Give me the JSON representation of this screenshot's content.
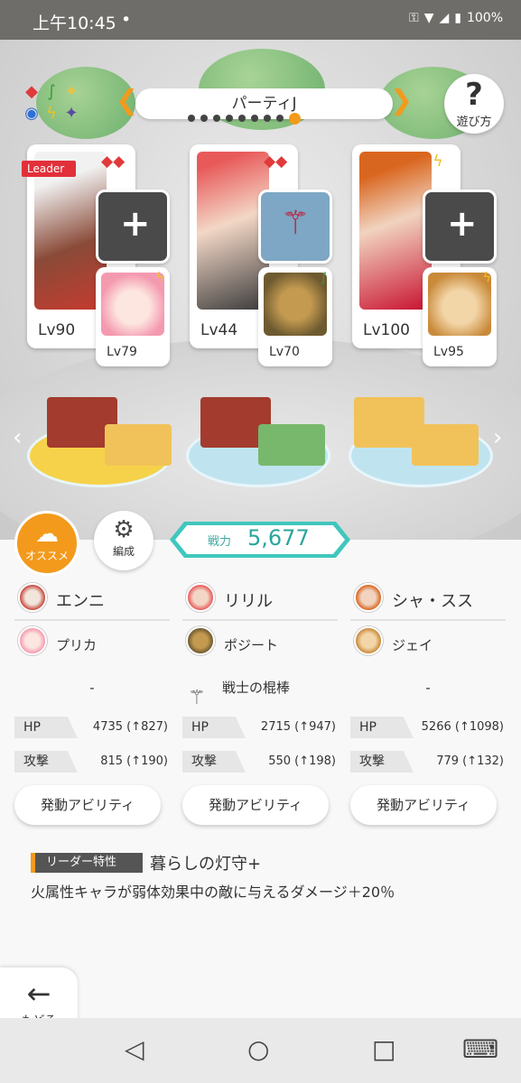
{
  "status": {
    "time": "上午10:45",
    "dot": "•",
    "battery": "100%"
  },
  "header": {
    "party_title": "パーティJ",
    "howto_label": "遊び方",
    "pages": 9,
    "active_page": 9
  },
  "colors": {
    "accent": "#f39a1c",
    "teal": "#3fc7bd",
    "fire": "#e03a3a"
  },
  "cards": [
    {
      "leader_label": "Leader",
      "level": "Lv90",
      "element": "fire",
      "sub_level": "Lv79",
      "slot": "empty"
    },
    {
      "level": "Lv44",
      "element": "fire",
      "sub_level": "Lv70",
      "slot": "weapon"
    },
    {
      "level": "Lv100",
      "element": "thunder",
      "sub_level": "Lv95",
      "slot": "empty"
    }
  ],
  "buttons": {
    "recommend": "オススメ",
    "formation": "編成",
    "back": "もどる"
  },
  "power": {
    "label": "戦力",
    "value": "5,677"
  },
  "columns": [
    {
      "main": "エンニ",
      "sub": "プリカ",
      "weapon": "-",
      "hp_label": "HP",
      "hp": "4735 (↑827)",
      "atk_label": "攻撃",
      "atk": "815 (↑190)",
      "ability": "発動アビリティ"
    },
    {
      "main": "リリル",
      "sub": "ポジート",
      "weapon": "戦士の棍棒",
      "hp_label": "HP",
      "hp": "2715 (↑947)",
      "atk_label": "攻撃",
      "atk": "550 (↑198)",
      "ability": "発動アビリティ"
    },
    {
      "main": "シャ・スス",
      "sub": "ジェイ",
      "weapon": "-",
      "hp_label": "HP",
      "hp": "5266 (↑1098)",
      "atk_label": "攻撃",
      "atk": "779 (↑132)",
      "ability": "発動アビリティ"
    }
  ],
  "leader_skill": {
    "tag": "リーダー特性",
    "name": "暮らしの灯守+",
    "description": "火属性キャラが弱体効果中の敵に与えるダメージ＋20％"
  }
}
